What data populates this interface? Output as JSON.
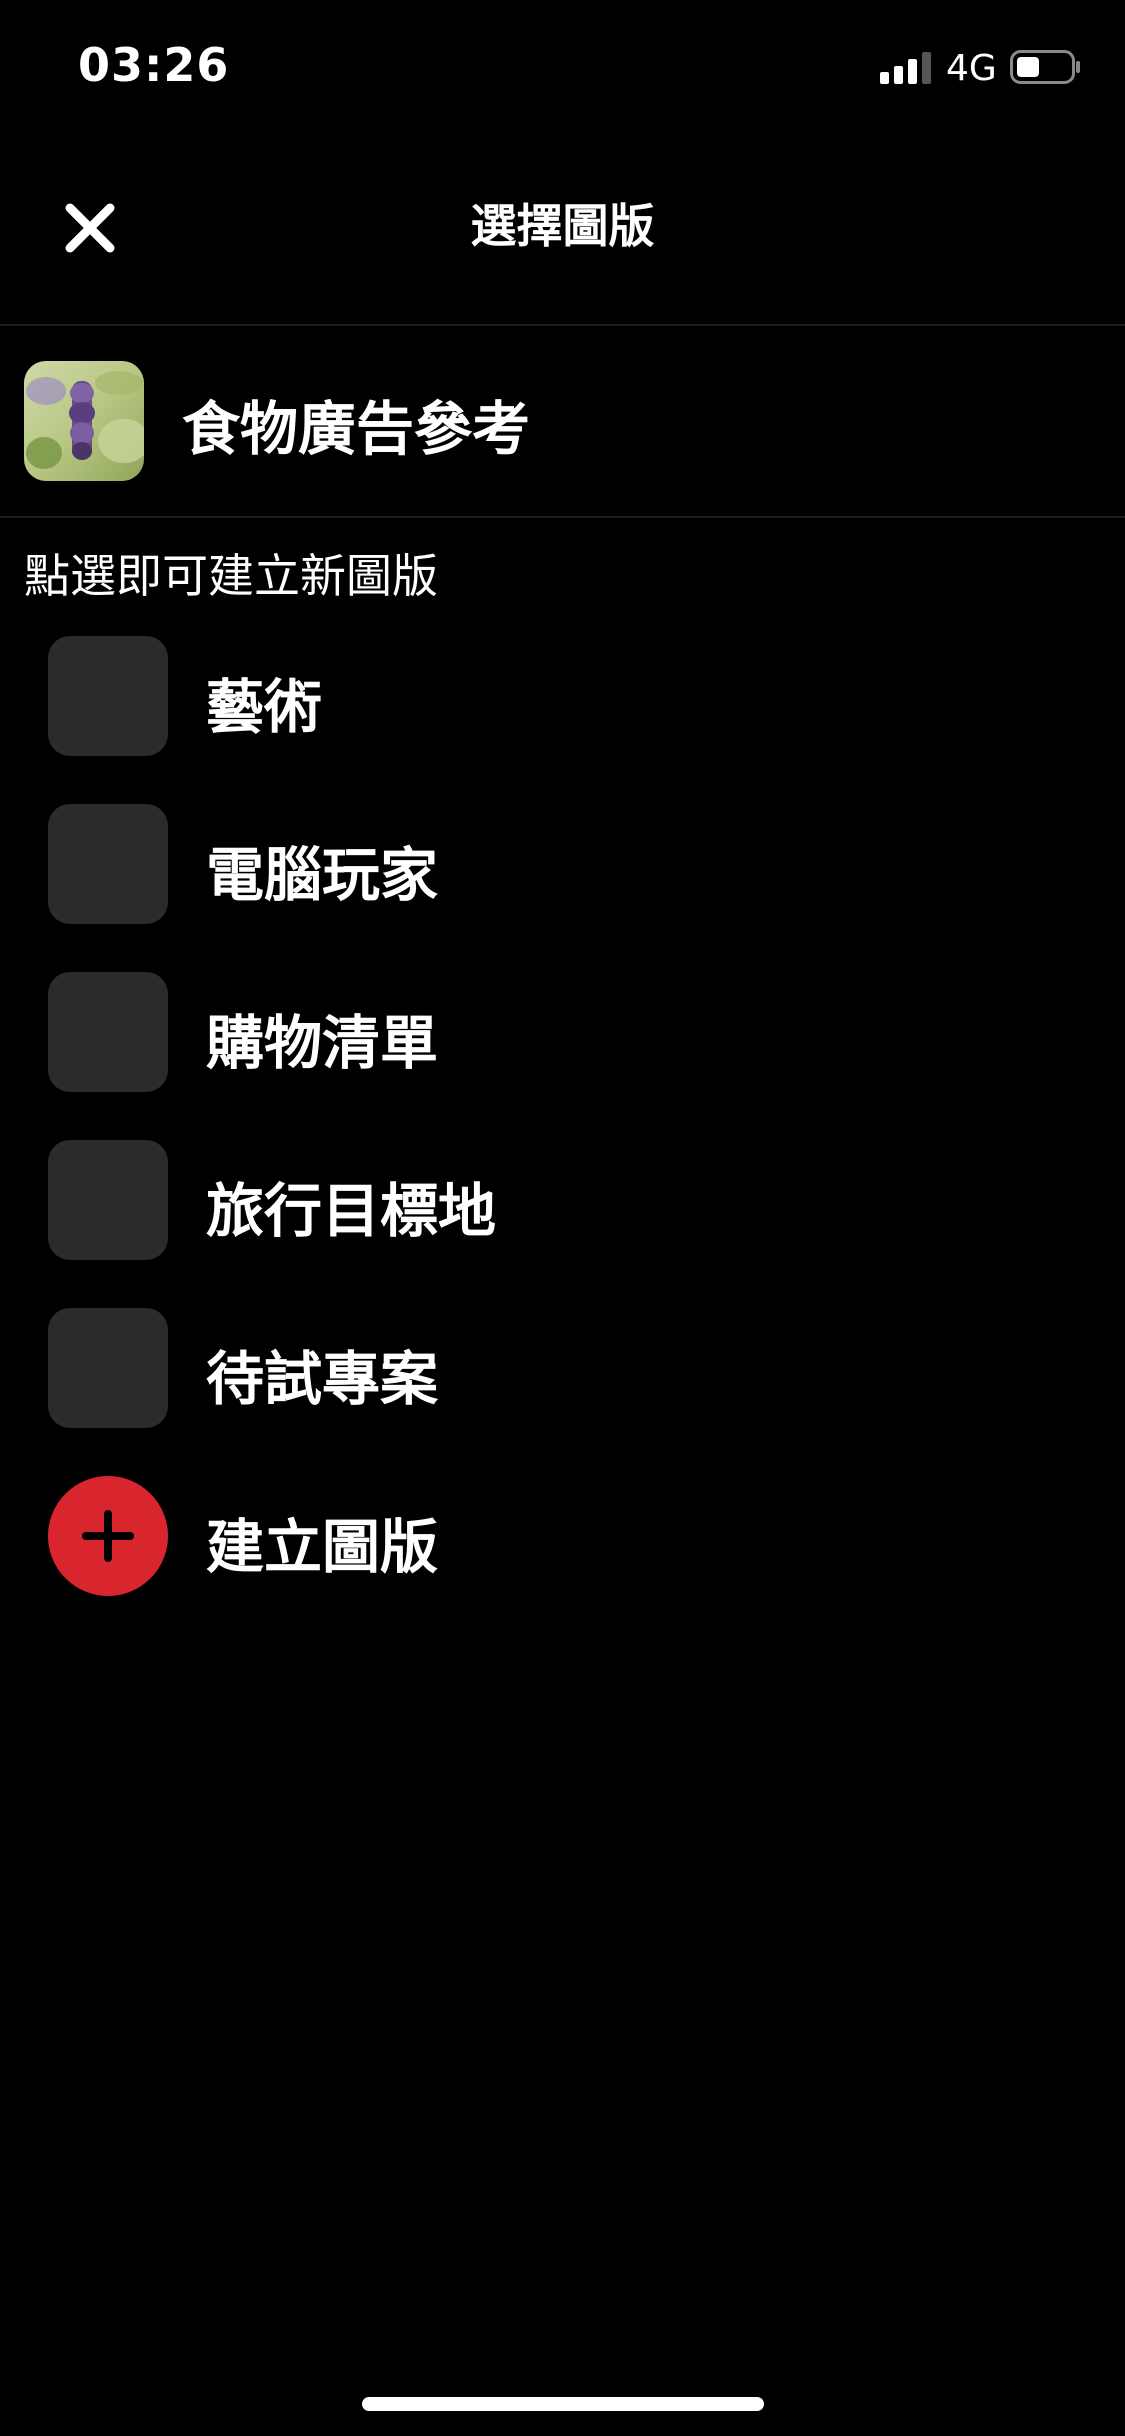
{
  "status_bar": {
    "time": "03:26",
    "network": "4G",
    "signal_icon": "cellular-signal-icon",
    "battery_icon": "battery-icon"
  },
  "header": {
    "title": "選擇圖版",
    "close_icon": "close-icon"
  },
  "current_board": {
    "label": "食物廣告參考",
    "thumbnail": "lavender-photo"
  },
  "section_hint": "點選即可建立新圖版",
  "boards": [
    {
      "label": "藝術"
    },
    {
      "label": "電腦玩家"
    },
    {
      "label": "購物清單"
    },
    {
      "label": "旅行目標地"
    },
    {
      "label": "待試專案"
    }
  ],
  "create_board": {
    "label": "建立圖版",
    "icon": "plus-icon"
  },
  "colors": {
    "background": "#000000",
    "accent": "#d9262e",
    "placeholder": "#2b2b2b",
    "text": "#ffffff"
  }
}
